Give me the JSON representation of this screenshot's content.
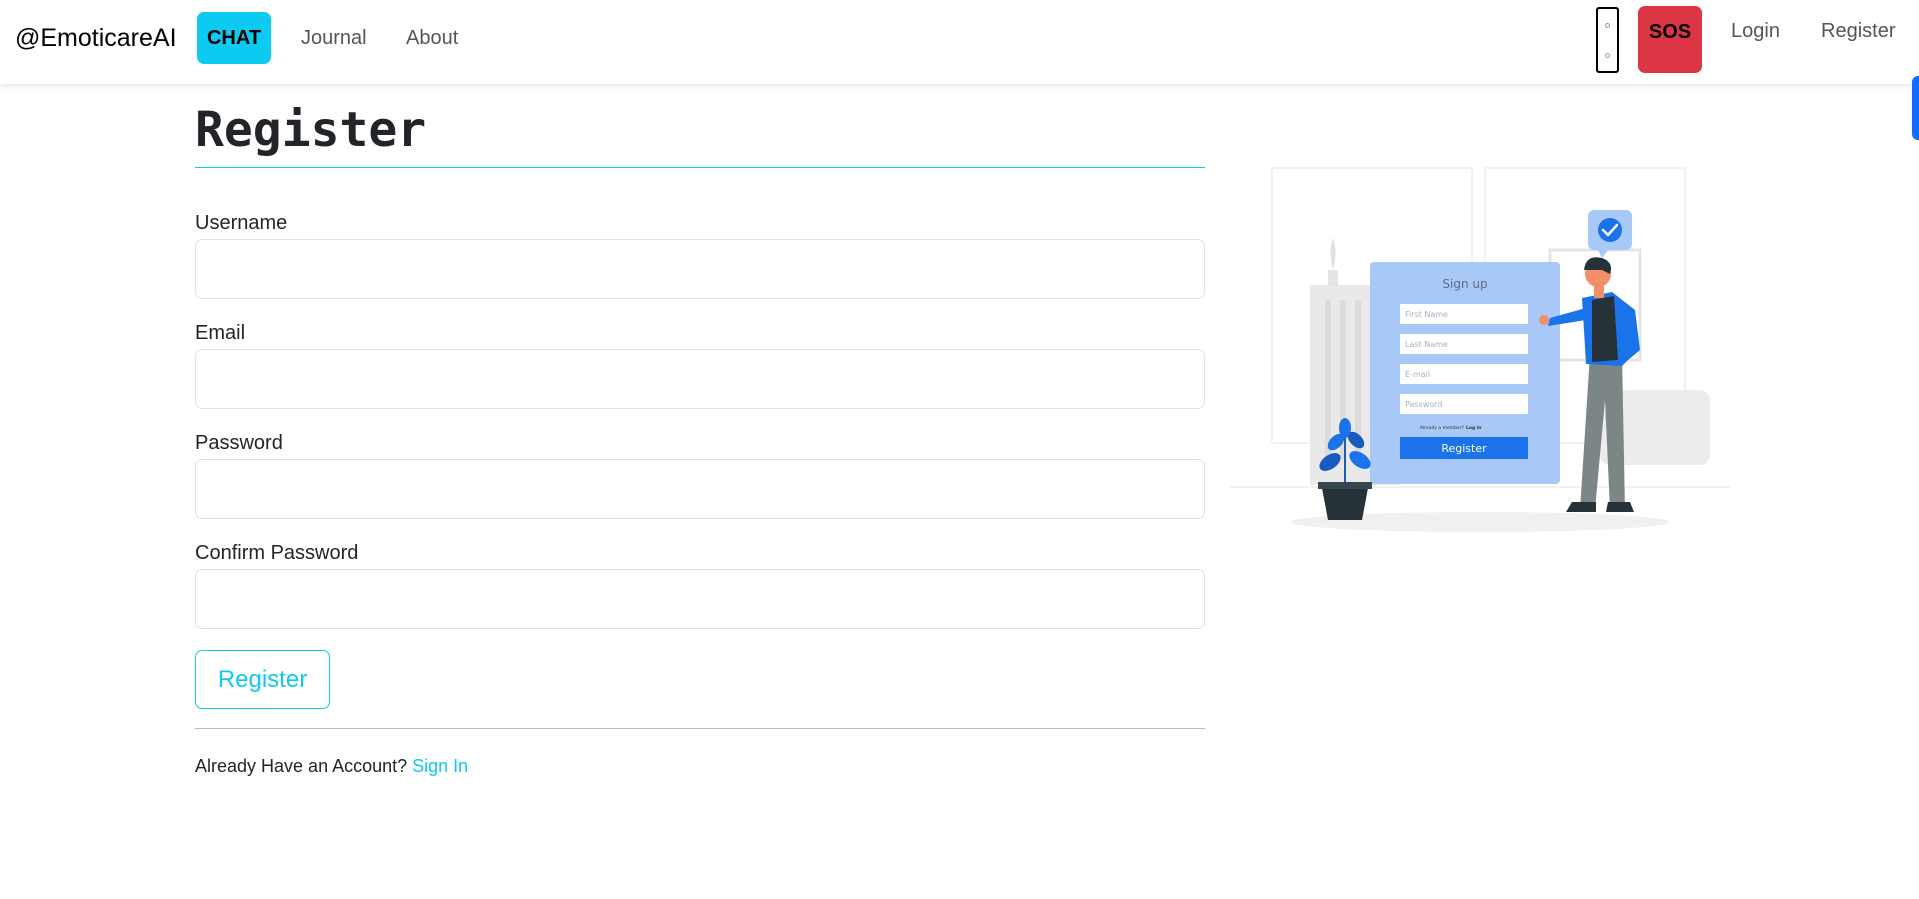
{
  "navbar": {
    "brand": "@EmoticareAI",
    "chat": "CHAT",
    "links": {
      "journal": "Journal",
      "about": "About"
    },
    "sos": "SOS",
    "login": "Login",
    "register": "Register"
  },
  "form": {
    "title": "Register",
    "fields": {
      "username": {
        "label": "Username",
        "value": ""
      },
      "email": {
        "label": "Email",
        "value": ""
      },
      "password": {
        "label": "Password",
        "value": ""
      },
      "confirm_password": {
        "label": "Confirm Password",
        "value": ""
      }
    },
    "submit": "Register",
    "account_prompt": "Already Have an Account?",
    "sign_in": "Sign In"
  },
  "illustration": {
    "heading": "Sign up",
    "placeholders": [
      "First Name",
      "Last Name",
      "E-mail",
      "Password"
    ],
    "member_text": "Already a member?",
    "login_text": "Log in",
    "button": "Register"
  },
  "colors": {
    "accent": "#0dcaf0",
    "danger": "#dc3545",
    "primary": "#0d6efd",
    "illustration_blue": "#1a73e8",
    "illustration_panel": "#a8c8f8"
  }
}
